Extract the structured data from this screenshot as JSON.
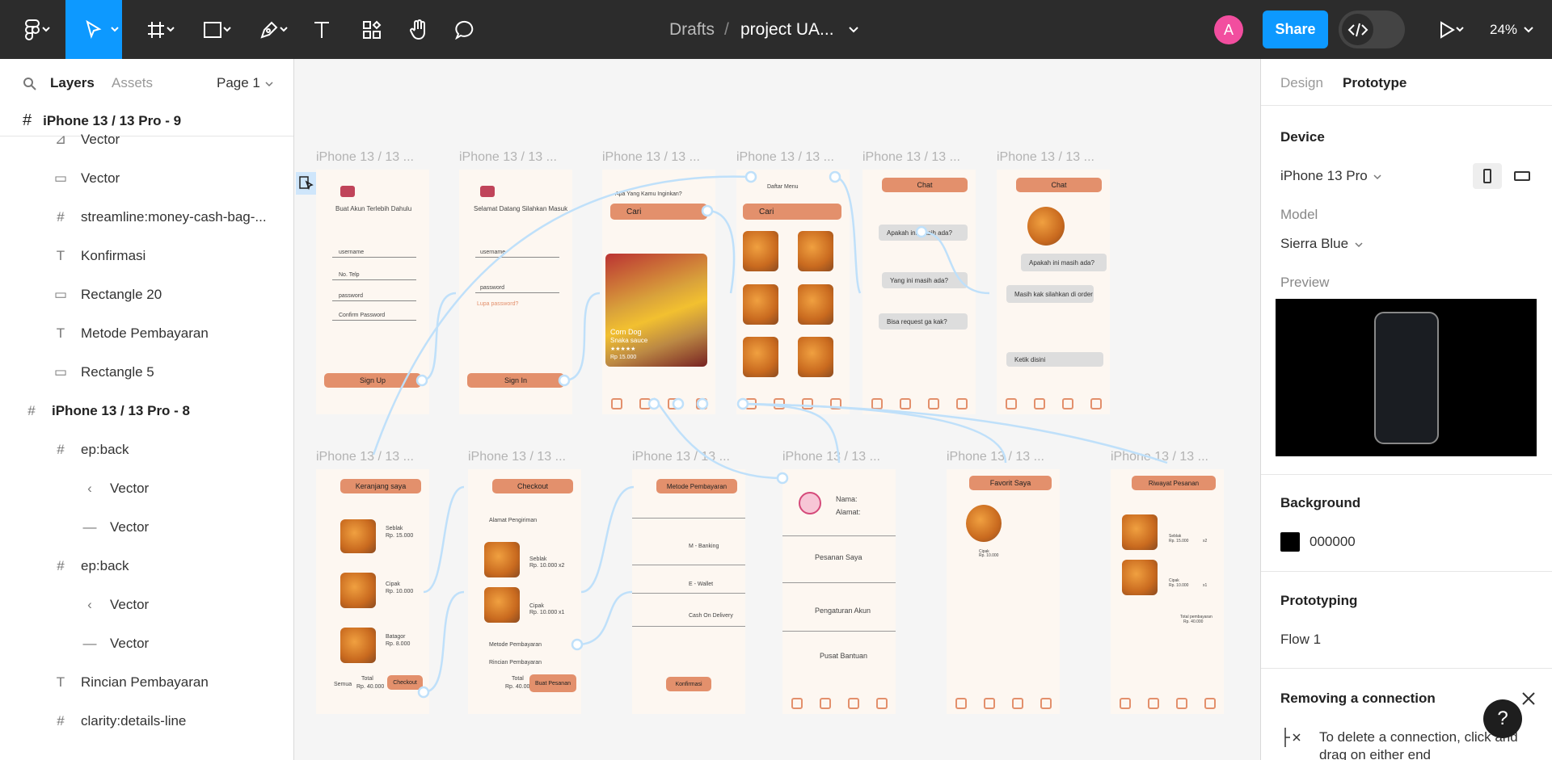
{
  "toolbar": {
    "breadcrumb_parent": "Drafts",
    "breadcrumb_sep": "/",
    "file_name": "project UA...",
    "avatar_initial": "A",
    "share_label": "Share",
    "zoom": "24%"
  },
  "left_panel": {
    "tab_layers": "Layers",
    "tab_assets": "Assets",
    "page": "Page 1",
    "frame_header": "iPhone 13 / 13 Pro - 9",
    "layers": [
      {
        "label": "Vector",
        "icon": "vector"
      },
      {
        "label": "Vector",
        "icon": "rect"
      },
      {
        "label": "streamline:money-cash-bag-...",
        "icon": "frame"
      },
      {
        "label": "Konfirmasi",
        "icon": "text"
      },
      {
        "label": "Rectangle 20",
        "icon": "rect"
      },
      {
        "label": "Metode Pembayaran",
        "icon": "text"
      },
      {
        "label": "Rectangle 5",
        "icon": "rect"
      },
      {
        "label": "iPhone 13 / 13 Pro - 8",
        "icon": "frame"
      },
      {
        "label": "ep:back",
        "icon": "frame"
      },
      {
        "label": "Vector",
        "icon": "chevron"
      },
      {
        "label": "Vector",
        "icon": "line"
      },
      {
        "label": "ep:back",
        "icon": "frame"
      },
      {
        "label": "Vector",
        "icon": "chevron"
      },
      {
        "label": "Vector",
        "icon": "line"
      },
      {
        "label": "Rincian Pembayaran",
        "icon": "text"
      },
      {
        "label": "clarity:details-line",
        "icon": "frame"
      }
    ]
  },
  "canvas": {
    "frame_label": "iPhone 13 / 13 ...",
    "signup": {
      "title": "Buat Akun Terlebih Dahulu",
      "f1": "username",
      "f2": "No. Telp",
      "f3": "password",
      "f4": "Confirm Password",
      "btn": "Sign Up"
    },
    "signin": {
      "title": "Selamat Datang Silahkan Masuk",
      "f1": "username",
      "f2": "password",
      "f3": "Lupa password?",
      "btn": "Sign In"
    },
    "home": {
      "title": "Apa Yang Kamu Inginkan?",
      "search": "Cari",
      "hero1": "Corn Dog",
      "hero2": "Snaka sauce",
      "price": "Rp 15.000"
    },
    "menu": {
      "title": "Daftar Menu",
      "search": "Cari"
    },
    "chat1": {
      "title": "Chat",
      "m1": "Apakah ini masih ada?",
      "m2": "Yang ini masih ada?",
      "m3": "Bisa request ga kak?"
    },
    "chat2": {
      "title": "Chat",
      "m1": "Apakah ini masih ada?",
      "m2": "Masih kak silahkan di order",
      "input": "Ketik disini"
    },
    "cart": {
      "title": "Keranjang saya",
      "i1": "Seblak",
      "p1": "Rp. 15.000",
      "i2": "Cipak",
      "p2": "Rp. 10.000",
      "i3": "Batagor",
      "p3": "Rp. 8.000",
      "all": "Semua",
      "total": "Total",
      "total_val": "Rp. 40.000",
      "btn": "Checkout"
    },
    "checkout": {
      "title": "Checkout",
      "addr": "Alamat Pengiriman",
      "i1": "Seblak",
      "p1": "Rp. 10.000",
      "q1": "x2",
      "i2": "Cipak",
      "p2": "Rp. 10.000",
      "q2": "x1",
      "pay": "Metode Pembayaran",
      "detail": "Rincian Pembayaran",
      "total": "Total",
      "total_val": "Rp. 40.000",
      "btn": "Buat Pesanan"
    },
    "payment": {
      "title": "Metode Pembayaran",
      "o1": "M - Banking",
      "o2": "E - Wallet",
      "o3": "Cash On Delivery",
      "btn": "Konfirmasi"
    },
    "profile": {
      "name": "Nama:",
      "addr": "Alamat:",
      "m1": "Pesanan Saya",
      "m2": "Pengaturan Akun",
      "m3": "Pusat Bantuan"
    },
    "fav": {
      "title": "Favorit Saya",
      "i1": "Cipak",
      "p1": "Rp. 10.000"
    },
    "history": {
      "title": "Riwayat Pesanan",
      "i1": "Seblak",
      "p1": "Rp. 15.000",
      "q1": "x2",
      "i2": "Cipak",
      "p2": "Rp. 10.000",
      "q2": "x1",
      "total": "Total pembayaran",
      "total_val": "Rp. 40.000"
    }
  },
  "right_panel": {
    "tab_design": "Design",
    "tab_prototype": "Prototype",
    "device_title": "Device",
    "device": "iPhone 13 Pro",
    "model_label": "Model",
    "model": "Sierra Blue",
    "preview_label": "Preview",
    "bg_title": "Background",
    "bg_value": "000000",
    "proto_title": "Prototyping",
    "flow": "Flow 1",
    "tip_title": "Removing a connection",
    "tip_text": "To delete a connection, click and drag on either end"
  },
  "colors": {
    "accent": "#0d99ff",
    "food_accent": "#e3906c",
    "connection": "#bfe0fa"
  }
}
